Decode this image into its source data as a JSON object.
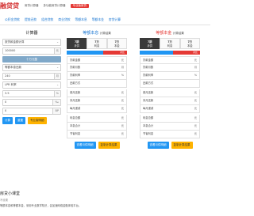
{
  "header": {
    "logo": "融贷贷",
    "nav": [
      "房贷计算器",
      "多功能房贷计算器",
      "专业版房贷"
    ]
  },
  "tabs": [
    "公积金贷款",
    "提前还款",
    "组合贷款",
    "商业贷款",
    "等额本息",
    "等额本金",
    "房贷计算"
  ],
  "calculator": {
    "title": "计算器",
    "loan_type": "按贷款金额计算",
    "amount": "100000",
    "amount_unit": "元",
    "banner": "十万元整",
    "repay_mode": "等额本息还款",
    "months": "240",
    "months_unit": "月",
    "rate_type": "LPR 利率",
    "rate": "3.5",
    "rate_unit": "%",
    "extra": "0",
    "extra_unit": "‰",
    "bp": "0",
    "bp_unit": "BP",
    "calc_button": "计算",
    "reset_button": "重置",
    "pro_button": "专业版明细"
  },
  "result_interest": {
    "title_hl": "等额本息",
    "title_rest": "计算结果",
    "terms": [
      {
        "years": "7期",
        "label": "月供"
      },
      {
        "years": "7万",
        "label": "利息"
      },
      {
        "years": "7万",
        "label": "本金"
      }
    ],
    "bar_label": "对比",
    "rows": [
      {
        "label": "贷款金额",
        "unit": "元"
      },
      {
        "label": "贷款月数",
        "unit": "月"
      },
      {
        "label": "贷款利率",
        "unit": "%"
      },
      {
        "label": "还款方式",
        "unit": ""
      },
      {
        "label": "首月还款",
        "unit": "元"
      },
      {
        "label": "末月还款",
        "unit": "元"
      },
      {
        "label": "每月递减",
        "unit": "元"
      },
      {
        "label": "利息总额",
        "unit": "元"
      },
      {
        "label": "本息合计",
        "unit": "元"
      },
      {
        "label": "节省利息",
        "unit": "元"
      }
    ],
    "btn_detail": "查看月供明细",
    "btn_copy": "复制计算结果"
  },
  "result_principal": {
    "title_hl": "等额本金",
    "title_rest": "计算结果",
    "terms": [
      {
        "years": "7期",
        "label": "月供"
      },
      {
        "years": "7万",
        "label": "利息"
      },
      {
        "years": "7万",
        "label": "本金"
      }
    ],
    "bar_label": "对比",
    "rows": [
      {
        "label": "贷款金额",
        "unit": "元"
      },
      {
        "label": "贷款月数",
        "unit": "月"
      },
      {
        "label": "贷款利率",
        "unit": "%"
      },
      {
        "label": "还款方式",
        "unit": ""
      },
      {
        "label": "首月还款",
        "unit": "元"
      },
      {
        "label": "末月还款",
        "unit": "元"
      },
      {
        "label": "每月递减",
        "unit": "元"
      },
      {
        "label": "利息总额",
        "unit": "元"
      },
      {
        "label": "本息合计",
        "unit": "元"
      },
      {
        "label": "节省利息",
        "unit": "元"
      }
    ],
    "btn_detail": "查看月供明细",
    "btn_copy": "复制计算结果"
  },
  "footer": {
    "title": "房贷小课堂",
    "sub": "不设置",
    "text": "等额本息和等额本金，采用专业数学知识，会加速网络金融体验平台。"
  },
  "colors": {
    "brand": "#d32f2f",
    "accent": "#2196f3",
    "warn": "#ffb300"
  }
}
